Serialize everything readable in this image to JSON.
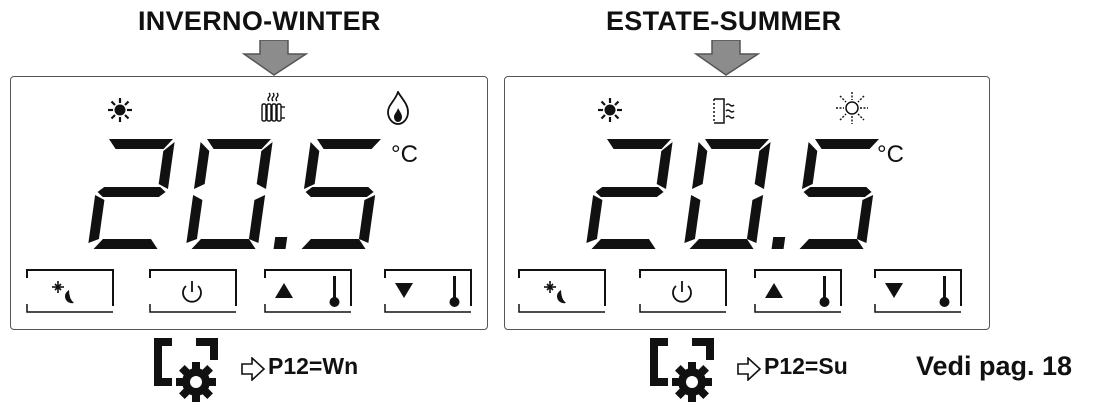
{
  "winter": {
    "title": "INVERNO-WINTER",
    "temperature": "20.5",
    "unit": "°C",
    "parameter": "P12=Wn",
    "status_icons": [
      "sun-icon",
      "radiator-icon",
      "flame-icon"
    ],
    "buttons": [
      "sun-moon-button",
      "power-button",
      "temp-up-button",
      "temp-down-button"
    ]
  },
  "summer": {
    "title": "ESTATE-SUMMER",
    "temperature": "20.5",
    "unit": "°C",
    "parameter": "P12=Su",
    "status_icons": [
      "sun-icon",
      "fan-coil-icon",
      "snowflake-icon"
    ],
    "buttons": [
      "sun-moon-button",
      "power-button",
      "temp-up-button",
      "temp-down-button"
    ]
  },
  "reference": "Vedi pag. 18",
  "colors": {
    "arrow": "#8c8c8c",
    "ink": "#111111",
    "border": "#555555"
  }
}
